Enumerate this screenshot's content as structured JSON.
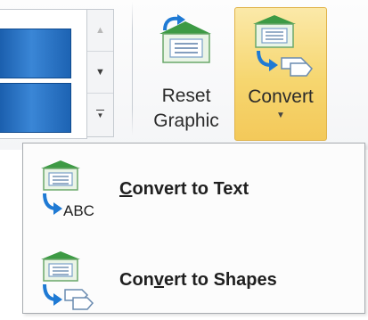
{
  "ribbon": {
    "gallery_scroll": {
      "up": "▲",
      "down": "▼",
      "more": "▼"
    },
    "reset_graphic": {
      "line1": "Reset",
      "line2": "Graphic",
      "icon": "reset-graphic-icon"
    },
    "convert": {
      "label": "Convert",
      "caret": "▼",
      "icon": "convert-icon",
      "state": "pressed"
    }
  },
  "menu": {
    "items": [
      {
        "label_accel": "C",
        "label_rest": "onvert to Text",
        "icon": "convert-to-text-icon",
        "icon_text": "ABC"
      },
      {
        "label_pre": "Con",
        "label_accel": "v",
        "label_rest": "ert to Shapes",
        "icon": "convert-to-shapes-icon"
      }
    ]
  },
  "colors": {
    "accent_pressed": "#f6d66f",
    "gallery_swatch": "#2a73c6",
    "icon_green": "#3d9a44",
    "icon_arrow_blue": "#1f7ad4"
  }
}
